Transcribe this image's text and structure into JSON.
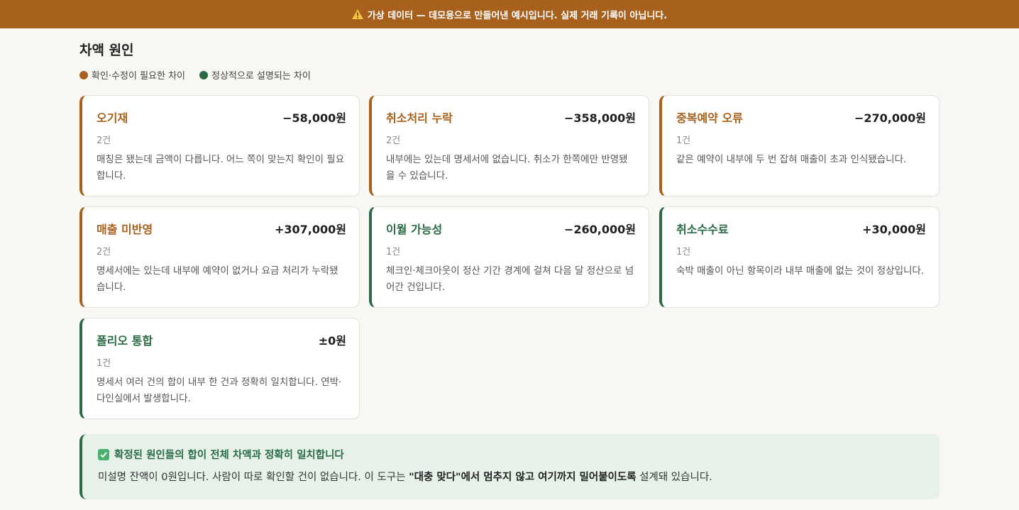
{
  "banner": {
    "text": "가상 데이터 — 데모용으로 만들어낸 예시입니다. 실제 거래 기록이 아닙니다."
  },
  "page": {
    "title": "차액 원인"
  },
  "legend": {
    "needs_fix": "확인·수정이 필요한 차이",
    "normal": "정상적으로 설명되는 차이"
  },
  "colors": {
    "needs_fix": "#a8611c",
    "normal": "#2a6b45",
    "summary_bg": "#e6f1ea"
  },
  "cards": [
    {
      "name": "오기재",
      "amount": "−58,000원",
      "count": "2건",
      "desc": "매칭은 됐는데 금액이 다릅니다. 어느 쪽이 맞는지 확인이 필요합니다.",
      "kind": "needs_fix"
    },
    {
      "name": "취소처리 누락",
      "amount": "−358,000원",
      "count": "2건",
      "desc": "내부에는 있는데 명세서에 없습니다. 취소가 한쪽에만 반영됐을 수 있습니다.",
      "kind": "needs_fix"
    },
    {
      "name": "중복예약 오류",
      "amount": "−270,000원",
      "count": "1건",
      "desc": "같은 예약이 내부에 두 번 잡혀 매출이 초과 인식됐습니다.",
      "kind": "needs_fix"
    },
    {
      "name": "매출 미반영",
      "amount": "+307,000원",
      "count": "2건",
      "desc": "명세서에는 있는데 내부에 예약이 없거나 요금 처리가 누락됐습니다.",
      "kind": "needs_fix"
    },
    {
      "name": "이월 가능성",
      "amount": "−260,000원",
      "count": "1건",
      "desc": "체크인·체크아웃이 정산 기간 경계에 걸쳐 다음 달 정산으로 넘어간 건입니다.",
      "kind": "normal"
    },
    {
      "name": "취소수수료",
      "amount": "+30,000원",
      "count": "1건",
      "desc": "숙박 매출이 아닌 항목이라 내부 매출에 없는 것이 정상입니다.",
      "kind": "normal"
    },
    {
      "name": "폴리오 통합",
      "amount": "±0원",
      "count": "1건",
      "desc": "명세서 여러 건의 합이 내부 한 건과 정확히 일치합니다. 연박·다인실에서 발생합니다.",
      "kind": "normal"
    }
  ],
  "summary": {
    "headline": "확정된 원인들의 합이 전체 차액과 정확히 일치합니다",
    "body_prefix": "미설명 잔액이 0원입니다. 사람이 따로 확인할 건이 없습니다. 이 도구는 ",
    "body_bold": "\"대충 맞다\"에서 멈추지 않고 여기까지 밀어붙이도록",
    "body_suffix": " 설계돼 있습니다."
  }
}
